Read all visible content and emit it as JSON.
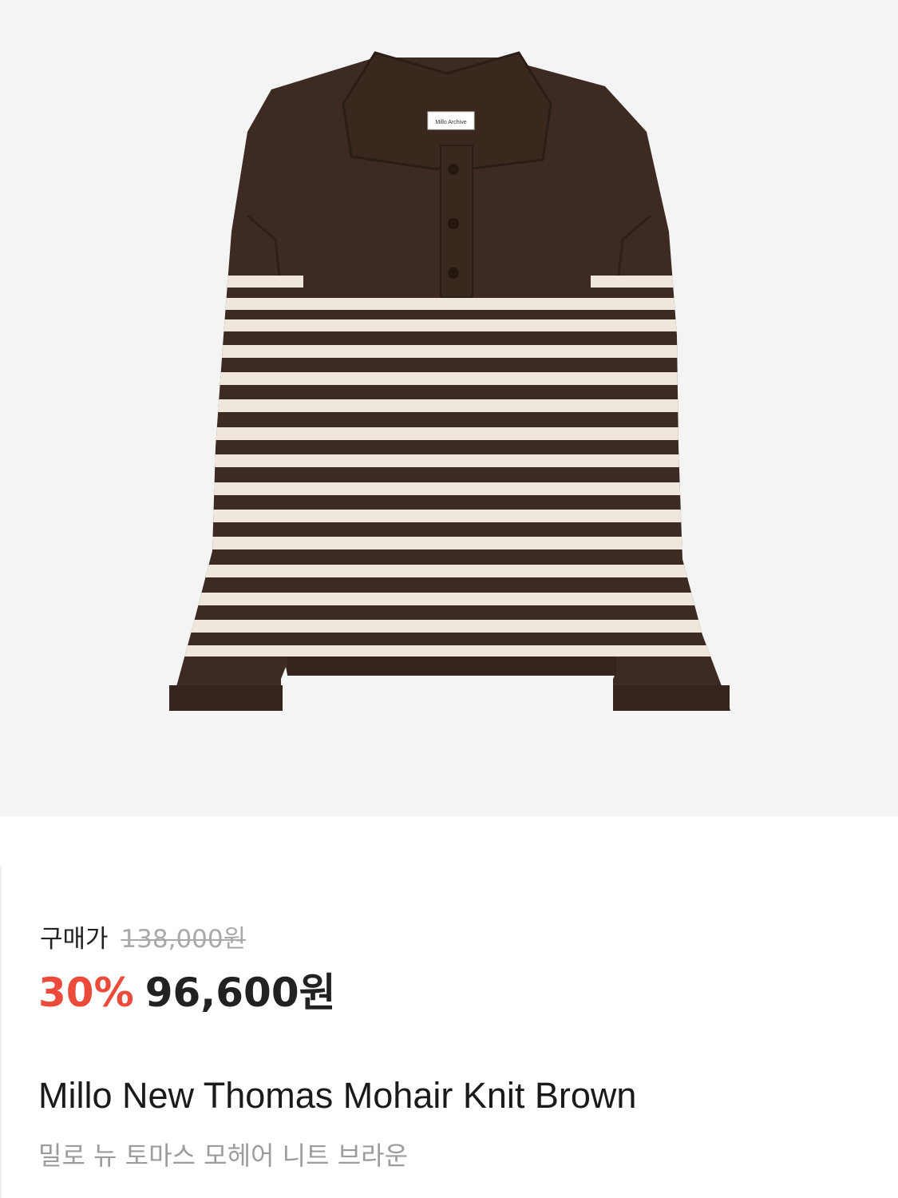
{
  "product": {
    "image": {
      "subject": "sweater-photo",
      "label_text": "Millo Archive",
      "body_color": "#3d2a22",
      "stripe_color": "#efe7dc"
    },
    "price": {
      "label": "구매가",
      "original": "138,000원",
      "discount": "30%",
      "final": "96,600원",
      "discount_color": "#ec4a3a"
    },
    "name_en": "Millo New Thomas Mohair Knit Brown",
    "name_ko": "밀로 뉴 토마스 모헤어 니트 브라운"
  }
}
